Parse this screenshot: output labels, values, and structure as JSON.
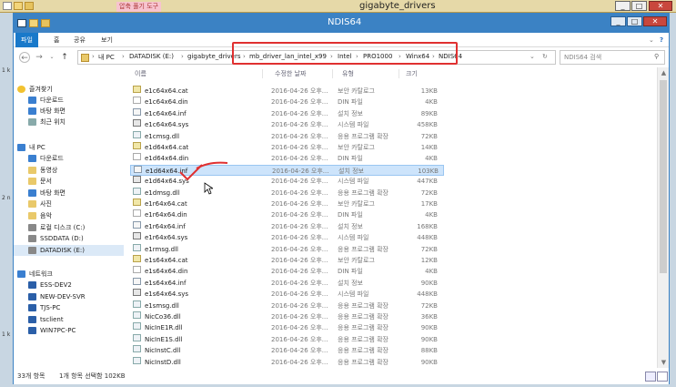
{
  "bg_window": {
    "title": "gigabyte_drivers",
    "context_tab": "압축 풀기 도구"
  },
  "window": {
    "title": "NDIS64",
    "minimize": "_",
    "maximize": "□",
    "close": "✕"
  },
  "ribbon": {
    "tabs": [
      "파일",
      "홈",
      "공유",
      "보기"
    ]
  },
  "address": {
    "back": "←",
    "forward": "→",
    "up": "↑",
    "crumbs": [
      "내 PC",
      "DATADISK (E:)",
      "gigabyte_drivers",
      "mb_driver_lan_intel_x99",
      "Intel",
      "PRO1000",
      "Winx64",
      "NDIS64"
    ],
    "search_placeholder": "NDIS64 검색"
  },
  "nav": {
    "favorites": "즐겨찾기",
    "fav_items": [
      "다운로드",
      "바탕 화면",
      "최근 위치"
    ],
    "this_pc": "내 PC",
    "pc_items": [
      "다운로드",
      "동영상",
      "문서",
      "바탕 화면",
      "사진",
      "음악",
      "로컬 디스크 (C:)",
      "SSDDATA (D:)",
      "DATADISK (E:)"
    ],
    "network": "네트워크",
    "net_items": [
      "ESS-DEV2",
      "NEW-DEV-SVR",
      "TJS-PC",
      "tsclient",
      "WIN7PC-PC"
    ]
  },
  "columns": {
    "name": "이름",
    "date": "수정한 날짜",
    "type": "유형",
    "size": "크기"
  },
  "files": [
    {
      "name": "e1c64x64.cat",
      "date": "2016-04-26 오후...",
      "type": "보안 카탈로그",
      "size": "13KB",
      "kind": "cat"
    },
    {
      "name": "e1c64x64.din",
      "date": "2016-04-26 오후...",
      "type": "DIN 파일",
      "size": "4KB",
      "kind": "din"
    },
    {
      "name": "e1c64x64.inf",
      "date": "2016-04-26 오후...",
      "type": "설치 정보",
      "size": "89KB",
      "kind": "inf"
    },
    {
      "name": "e1c64x64.sys",
      "date": "2016-04-26 오후...",
      "type": "시스템 파일",
      "size": "458KB",
      "kind": "sys"
    },
    {
      "name": "e1cmsg.dll",
      "date": "2016-04-26 오후...",
      "type": "응용 프로그램 확장",
      "size": "72KB",
      "kind": "dll"
    },
    {
      "name": "e1d64x64.cat",
      "date": "2016-04-26 오후...",
      "type": "보안 카탈로그",
      "size": "14KB",
      "kind": "cat"
    },
    {
      "name": "e1d64x64.din",
      "date": "2016-04-26 오후...",
      "type": "DIN 파일",
      "size": "4KB",
      "kind": "din"
    },
    {
      "name": "e1d64x64.inf",
      "date": "2016-04-26 오후...",
      "type": "설치 정보",
      "size": "103KB",
      "kind": "inf",
      "selected": true
    },
    {
      "name": "e1d64x64.sys",
      "date": "2016-04-26 오후...",
      "type": "시스템 파일",
      "size": "447KB",
      "kind": "sys"
    },
    {
      "name": "e1dmsg.dll",
      "date": "2016-04-26 오후...",
      "type": "응용 프로그램 확장",
      "size": "72KB",
      "kind": "dll"
    },
    {
      "name": "e1r64x64.cat",
      "date": "2016-04-26 오후...",
      "type": "보안 카탈로그",
      "size": "17KB",
      "kind": "cat"
    },
    {
      "name": "e1r64x64.din",
      "date": "2016-04-26 오후...",
      "type": "DIN 파일",
      "size": "4KB",
      "kind": "din"
    },
    {
      "name": "e1r64x64.inf",
      "date": "2016-04-26 오후...",
      "type": "설치 정보",
      "size": "168KB",
      "kind": "inf"
    },
    {
      "name": "e1r64x64.sys",
      "date": "2016-04-26 오후...",
      "type": "시스템 파일",
      "size": "448KB",
      "kind": "sys"
    },
    {
      "name": "e1rmsg.dll",
      "date": "2016-04-26 오후...",
      "type": "응용 프로그램 확장",
      "size": "72KB",
      "kind": "dll"
    },
    {
      "name": "e1s64x64.cat",
      "date": "2016-04-26 오후...",
      "type": "보안 카탈로그",
      "size": "12KB",
      "kind": "cat"
    },
    {
      "name": "e1s64x64.din",
      "date": "2016-04-26 오후...",
      "type": "DIN 파일",
      "size": "4KB",
      "kind": "din"
    },
    {
      "name": "e1s64x64.inf",
      "date": "2016-04-26 오후...",
      "type": "설치 정보",
      "size": "90KB",
      "kind": "inf"
    },
    {
      "name": "e1s64x64.sys",
      "date": "2016-04-26 오후...",
      "type": "시스템 파일",
      "size": "448KB",
      "kind": "sys"
    },
    {
      "name": "e1smsg.dll",
      "date": "2016-04-26 오후...",
      "type": "응용 프로그램 확장",
      "size": "72KB",
      "kind": "dll"
    },
    {
      "name": "NicCo36.dll",
      "date": "2016-04-26 오후...",
      "type": "응용 프로그램 확장",
      "size": "36KB",
      "kind": "dll"
    },
    {
      "name": "NicInE1R.dll",
      "date": "2016-04-26 오후...",
      "type": "응용 프로그램 확장",
      "size": "90KB",
      "kind": "dll"
    },
    {
      "name": "NicInE1S.dll",
      "date": "2016-04-26 오후...",
      "type": "응용 프로그램 확장",
      "size": "90KB",
      "kind": "dll"
    },
    {
      "name": "NicInstC.dll",
      "date": "2016-04-26 오후...",
      "type": "응용 프로그램 확장",
      "size": "88KB",
      "kind": "dll"
    },
    {
      "name": "NicInstD.dll",
      "date": "2016-04-26 오후...",
      "type": "응용 프로그램 확장",
      "size": "90KB",
      "kind": "dll"
    }
  ],
  "status": {
    "count": "33개 항목",
    "selection": "1개 항목 선택함 102KB"
  },
  "left_strip": [
    "1 k",
    "2 n",
    "1 k"
  ],
  "colors": {
    "title_bar": "#3b82c4",
    "selection": "#cde4fb",
    "highlight_box": "#e03030",
    "annotation": "#e03030"
  }
}
